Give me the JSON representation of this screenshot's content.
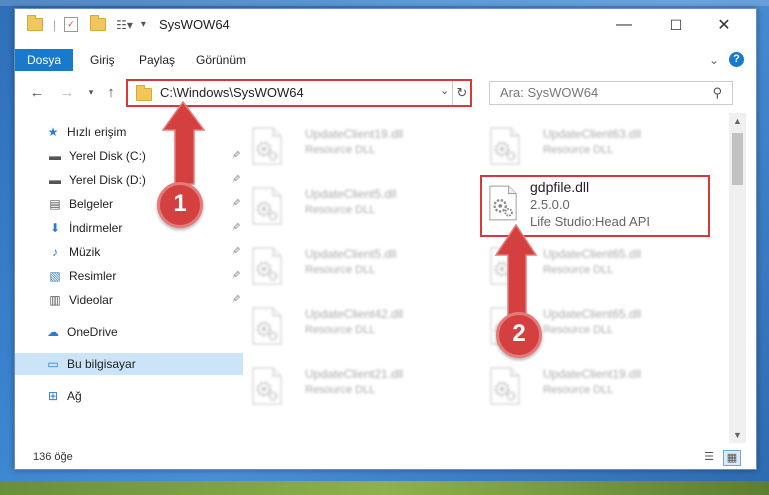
{
  "window": {
    "title": "SysWOW64",
    "controls": {
      "minimize": "—",
      "maximize": "☐",
      "close": "✕"
    }
  },
  "ribbon": {
    "tabs": [
      "Dosya",
      "Giriş",
      "Paylaş",
      "Görünüm"
    ],
    "expand": "⌄",
    "help": "?"
  },
  "address": {
    "path": "C:\\Windows\\SysWOW64",
    "search_placeholder": "Ara: SysWOW64"
  },
  "sidebar": {
    "items": [
      {
        "label": "Hızlı erişim",
        "icon": "star-icon",
        "pinned": false
      },
      {
        "label": "Yerel Disk (C:)",
        "icon": "drive-icon",
        "pinned": true
      },
      {
        "label": "Yerel Disk (D:)",
        "icon": "drive-icon",
        "pinned": true
      },
      {
        "label": "Belgeler",
        "icon": "documents-icon",
        "pinned": true
      },
      {
        "label": "İndirmeler",
        "icon": "download-icon",
        "pinned": true
      },
      {
        "label": "Müzik",
        "icon": "music-icon",
        "pinned": true
      },
      {
        "label": "Resimler",
        "icon": "pictures-icon",
        "pinned": true
      },
      {
        "label": "Videolar",
        "icon": "videos-icon",
        "pinned": true
      },
      {
        "label": "OneDrive",
        "icon": "cloud-icon",
        "pinned": false
      },
      {
        "label": "Bu bilgisayar",
        "icon": "computer-icon",
        "pinned": false,
        "selected": true
      },
      {
        "label": "Ağ",
        "icon": "network-icon",
        "pinned": false
      }
    ]
  },
  "files": {
    "left_column": [
      {
        "name": "UpdateClient19.dll",
        "type": "Resource DLL"
      },
      {
        "name": "UpdateClient5.dll",
        "type": "Resource DLL"
      },
      {
        "name": "UpdateClient5.dll",
        "type": "Resource DLL"
      },
      {
        "name": "UpdateClient42.dll",
        "type": "Resource DLL"
      },
      {
        "name": "UpdateClient21.dll",
        "type": "Resource DLL"
      }
    ],
    "right_column": [
      {
        "name": "UpdateClient63.dll",
        "type": "Resource DLL"
      },
      {
        "name": "UpdateClient65.dll",
        "type": "Resource DLL"
      },
      {
        "name": "UpdateClient65.dll",
        "type": "Resource DLL"
      },
      {
        "name": "UpdateClient19.dll",
        "type": "Resource DLL"
      }
    ],
    "highlighted": {
      "name": "gdpfile.dll",
      "version": "2.5.0.0",
      "description": "Life Studio:Head API"
    }
  },
  "status": {
    "item_count": "136 öğe"
  },
  "annotations": {
    "step1": "1",
    "step2": "2",
    "color": "#d9373b"
  }
}
